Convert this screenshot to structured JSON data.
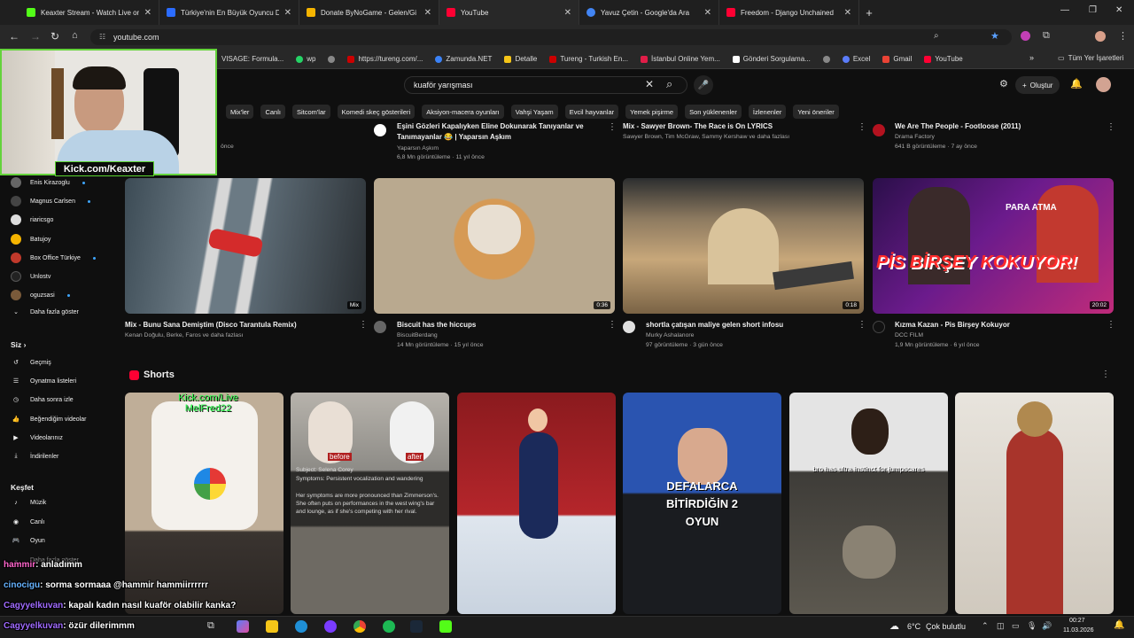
{
  "browser": {
    "tabs": [
      {
        "title": "Keaxter Stream - Watch Live on",
        "color": "#53fc18"
      },
      {
        "title": "Türkiye'nin En Büyük Oyuncu D",
        "color": "#2b6cff"
      },
      {
        "title": "Donate ByNoGame - Gelen/Gi",
        "color": "#f5b400"
      },
      {
        "title": "YouTube",
        "color": "#ff0033"
      },
      {
        "title": "Yavuz Çetin - Google'da Ara",
        "color": "#4285f4"
      },
      {
        "title": "Freedom - Django Unchained",
        "color": "#ff0033"
      }
    ],
    "url": "youtube.com",
    "bookmarks": [
      {
        "label": "VISAGE: Formula...",
        "color": "#777"
      },
      {
        "label": "wp",
        "color": "#25d366"
      },
      {
        "label": "",
        "color": "#888"
      },
      {
        "label": "https://tureng.com/...",
        "color": "#c00"
      },
      {
        "label": "Zamunda.NET",
        "color": "#3b82f6"
      },
      {
        "label": "Detalle",
        "color": "#f5c518"
      },
      {
        "label": "Tureng - Turkish En...",
        "color": "#c00"
      },
      {
        "label": "İstanbul Online Yem...",
        "color": "#e11d48"
      },
      {
        "label": "Gönderi Sorgulama...",
        "color": "#fff"
      },
      {
        "label": "",
        "color": "#888"
      },
      {
        "label": "Excel",
        "color": "#5b7cfa"
      },
      {
        "label": "Gmail",
        "color": "#ea4335"
      },
      {
        "label": "YouTube",
        "color": "#ff0033"
      }
    ],
    "all_bookmarks": "Tüm Yer İşaretleri"
  },
  "youtube": {
    "search_value": "kuaför yarışması",
    "create_label": "Oluştur",
    "chips": [
      "Mix'ler",
      "Canlı",
      "Sitcom'lar",
      "Komedi skeç gösterileri",
      "Aksiyon-macera oyunları",
      "Vahşi Yaşam",
      "Evcil hayvanlar",
      "Yemek pişirme",
      "Son yüklenenler",
      "İzlenenler",
      "Yeni öneriler"
    ],
    "top_row": [
      {
        "title": "Eşini Gözleri Kapalıyken Eline Dokunarak Tanıyanlar ve",
        "title2": "Tanımayanlar 😂 | Yaparsın Aşkım",
        "meta1": "Yaparsın Aşkım",
        "meta2": "6,8 Mn görüntüleme · 11 yıl önce"
      },
      {
        "title": "Mix - Sawyer Brown- The Race is On LYRICS",
        "meta1": "Sawyer Brown, Tim McGraw, Sammy Kershaw ve daha fazlası",
        "meta2": ""
      },
      {
        "title": "We Are The People - Footloose (2011)",
        "meta1": "Drama Factory",
        "meta2": "641 B görüntüleme · 7 ay önce"
      }
    ],
    "top_left_partial": "önce",
    "videos": [
      {
        "title": "Mix - Bunu Sana Demiştim (Disco Tarantula Remix)",
        "channel": "Kenan Doğulu, Berke, Faros ve daha fazlası",
        "stats": "",
        "duration": "Mix",
        "bg": "#4a5a66"
      },
      {
        "title": "Biscuit has the hiccups",
        "channel": "BiscuitBerdang",
        "stats": "14 Mn görüntüleme · 15 yıl önce",
        "duration": "0:36",
        "bg": "#8a7565"
      },
      {
        "title": "shortla çatışan maliye gelen short infosu",
        "channel": "Murky Ashalanore",
        "stats": "97 görüntüleme · 3 gün önce",
        "duration": "0:18",
        "bg": "#7a6a52"
      },
      {
        "title": "Kızma Kazan - Pis Birşey Kokuyor",
        "channel": "DCC FILM",
        "stats": "1,9 Mn görüntüleme · 6 yıl önce",
        "duration": "20:02",
        "bg": "#5a2a6a"
      }
    ],
    "thumb_text": "PİS BİRŞEY KOKUYOR!",
    "thumb_small": "PARA ATMA",
    "shorts_heading": "Shorts",
    "shorts": [
      {
        "bg": "#b9a48e",
        "caption": "Kick.com/Live MelFred22"
      },
      {
        "bg": "#8d8b86",
        "caption": "Subject: Selena Corey"
      },
      {
        "bg": "#7b1a1e",
        "caption": ""
      },
      {
        "bg": "#2f4f8f",
        "caption": "DEFALARCA BİTİRDİĞİN 2 OYUN"
      },
      {
        "bg": "#3b3a36",
        "caption": "bro has ultra instinct for jumpscares"
      },
      {
        "bg": "#d9d4cc",
        "caption": ""
      }
    ],
    "short_labels": {
      "before": "before",
      "after": "after",
      "symptoms": "Symptoms: Persistent vocalization and wandering",
      "body": "Her symptoms are more pronounced than Zimmerson's. She often puts on performances in the west wing's bar and lounge, as if she's competing with her rival."
    }
  },
  "sidebar": {
    "subs": [
      {
        "name": "Enis Kirazoglu",
        "dot": true,
        "color": "#666"
      },
      {
        "name": "Magnus Carlsen",
        "dot": true,
        "color": "#444"
      },
      {
        "name": "riaricsgo",
        "dot": false,
        "color": "#ddd"
      },
      {
        "name": "Batujoy",
        "dot": false,
        "color": "#f5b400"
      },
      {
        "name": "Box Office Türkiye",
        "dot": true,
        "color": "#c0392b"
      },
      {
        "name": "Unlostv",
        "dot": false,
        "color": "#222"
      },
      {
        "name": "oguzsasi",
        "dot": true,
        "color": "#7a5a3a"
      }
    ],
    "more": "Daha fazla göster",
    "you": "Siz",
    "you_items": [
      "Geçmiş",
      "Oynatma listeleri",
      "Daha sonra izle",
      "Beğendiğim videolar",
      "Videolarınız",
      "İndirilenler"
    ],
    "explore": "Keşfet",
    "explore_items": [
      "Müzik",
      "Canlı",
      "Oyun"
    ],
    "explore_more": "Daha fazla göster"
  },
  "overlay": {
    "kick_text": "Kick.com/Keaxter",
    "chat": [
      {
        "user": "hammir",
        "msg": ": anladımm",
        "color": "#ff66cc"
      },
      {
        "user": "cinocigu",
        "msg": ": sorma sormaaa @hammir hammiirrrrrr",
        "color": "#66b3ff"
      },
      {
        "user": "Cagyyelkuvan",
        "msg": ": kapalı kadın nasıl kuaför olabilir kanka?",
        "color": "#a06bff"
      },
      {
        "user": "Cagyyelkuvan",
        "msg": ": özür dilerimmm",
        "color": "#a06bff"
      }
    ]
  },
  "taskbar": {
    "weather": "6°C",
    "weather_desc": "Çok bulutlu",
    "time": "00:27",
    "date": "11.03.2026"
  }
}
